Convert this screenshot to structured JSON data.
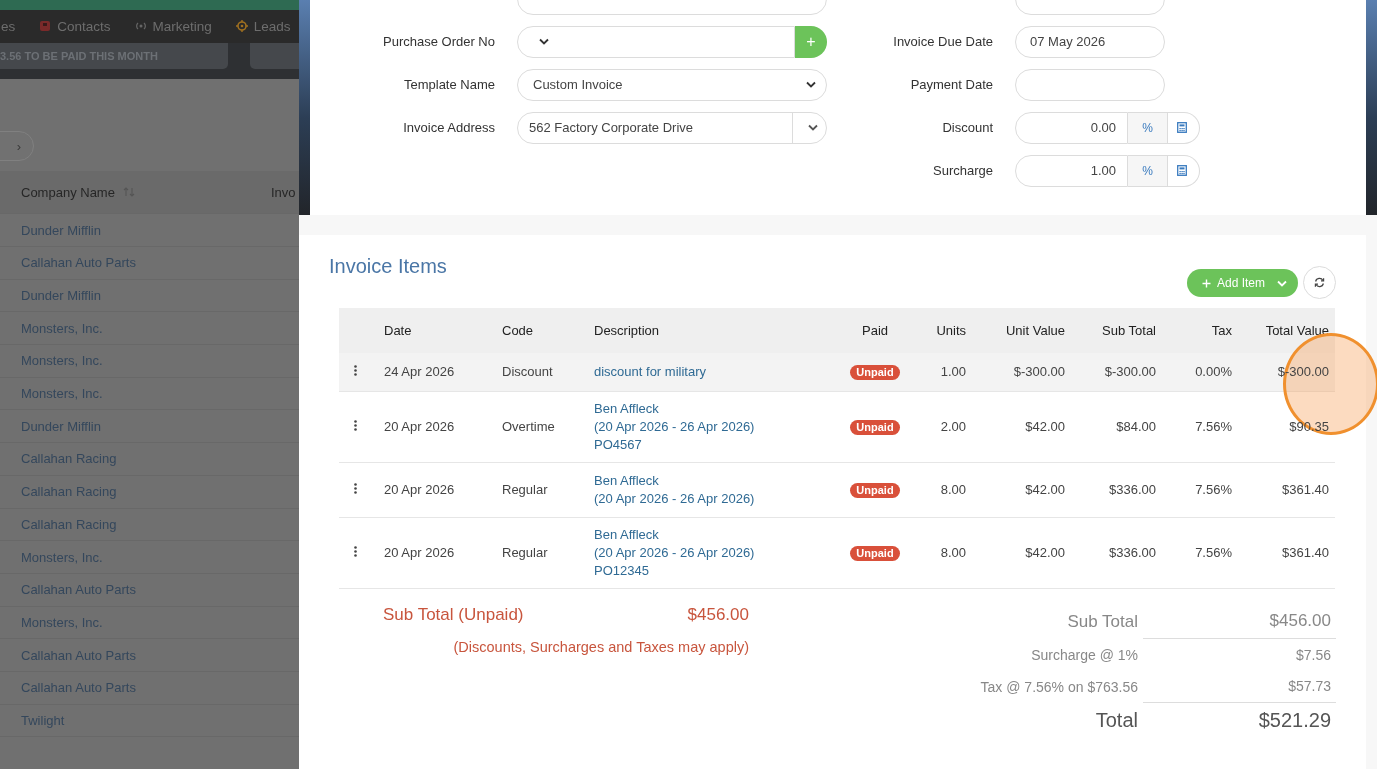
{
  "background_app": {
    "nav_items": [
      {
        "label": "es"
      },
      {
        "label": "Contacts"
      },
      {
        "label": "Marketing"
      },
      {
        "label": "Leads"
      }
    ],
    "summary_text": "3.56 TO BE PAID THIS MONTH",
    "pager_next": "›",
    "table": {
      "columns": [
        "Company Name"
      ],
      "rows": [
        "Dunder Mifflin",
        "Callahan Auto Parts",
        "Dunder Mifflin",
        "Monsters, Inc.",
        "Monsters, Inc.",
        "Monsters, Inc.",
        "Dunder Mifflin",
        "Callahan Racing",
        "Callahan Racing",
        "Callahan Racing",
        "Monsters, Inc.",
        "Callahan Auto Parts",
        "Monsters, Inc.",
        "Callahan Auto Parts",
        "Callahan Auto Parts",
        "Twilight"
      ],
      "column_2_heading": "Invo"
    }
  },
  "invoice_form": {
    "left_fields": [
      {
        "label": "Purchase Order No",
        "kind": "select_add",
        "button": "+"
      },
      {
        "label": "Template Name",
        "kind": "select",
        "value": "Custom Invoice"
      },
      {
        "label": "Invoice Address",
        "kind": "combo",
        "value": "562 Factory Corporate Drive"
      }
    ],
    "right_fields": [
      {
        "label": "Invoice Due Date",
        "kind": "text",
        "value": "07 May 2026"
      },
      {
        "label": "Payment Date",
        "kind": "text"
      },
      {
        "label": "Discount",
        "kind": "percent",
        "value": "0.00",
        "unit": "%"
      },
      {
        "label": "Surcharge",
        "kind": "percent",
        "value": "1.00",
        "unit": "%"
      }
    ]
  },
  "invoice_items": {
    "title": "Invoice Items",
    "add_button": "Add Item",
    "columns": [
      "Date",
      "Code",
      "Description",
      "Paid",
      "Units",
      "Unit Value",
      "Sub Total",
      "Tax",
      "Total Value"
    ],
    "rows": [
      {
        "date": "24 Apr 2026",
        "code": "Discount",
        "description": [
          "discount for military"
        ],
        "paid": "Unpaid",
        "units": "1.00",
        "unit_value": "$-300.00",
        "sub_total": "$-300.00",
        "tax": "0.00%",
        "total_value": "$-300.00",
        "highlighted": true
      },
      {
        "date": "20 Apr 2026",
        "code": "Overtime",
        "description": [
          "Ben Affleck",
          "(20 Apr 2026 - 26 Apr 2026)",
          "PO4567"
        ],
        "paid": "Unpaid",
        "units": "2.00",
        "unit_value": "$42.00",
        "sub_total": "$84.00",
        "tax": "7.56%",
        "total_value": "$90.35",
        "highlighted": false
      },
      {
        "date": "20 Apr 2026",
        "code": "Regular",
        "description": [
          "Ben Affleck",
          "(20 Apr 2026 - 26 Apr 2026)"
        ],
        "paid": "Unpaid",
        "units": "8.00",
        "unit_value": "$42.00",
        "sub_total": "$336.00",
        "tax": "7.56%",
        "total_value": "$361.40",
        "highlighted": false
      },
      {
        "date": "20 Apr 2026",
        "code": "Regular",
        "description": [
          "Ben Affleck",
          "(20 Apr 2026 - 26 Apr 2026)",
          "PO12345"
        ],
        "paid": "Unpaid",
        "units": "8.00",
        "unit_value": "$42.00",
        "sub_total": "$336.00",
        "tax": "7.56%",
        "total_value": "$361.40",
        "highlighted": false
      }
    ],
    "unpaid": {
      "label": "Sub Total (Unpaid)",
      "value": "$456.00",
      "note": "(Discounts, Surcharges and Taxes may apply)"
    },
    "totals": [
      {
        "label": "Sub Total",
        "value": "$456.00",
        "kind": "subtotal"
      },
      {
        "label": "Surcharge @ 1%",
        "value": "$7.56",
        "kind": "line"
      },
      {
        "label": "Tax @ 7.56% on $763.56",
        "value": "$57.73",
        "kind": "line"
      },
      {
        "label": "Total",
        "value": "$521.29",
        "kind": "total"
      }
    ]
  }
}
